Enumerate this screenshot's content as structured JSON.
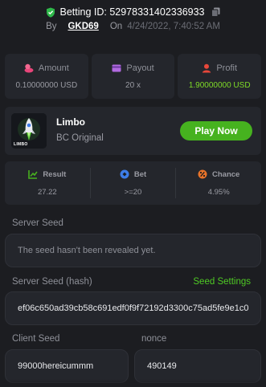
{
  "header": {
    "betting_id": "Betting ID: 52978331402336933",
    "by_label": "By",
    "username": "GKD69",
    "on_label": "On",
    "date": "4/24/2022, 7:40:52 AM"
  },
  "stats": [
    {
      "label": "Amount",
      "value": "0.10000000 USD",
      "icon": "coins-icon",
      "color": "#e8457a"
    },
    {
      "label": "Payout",
      "value": "20 x",
      "icon": "card-icon",
      "color": "#b26ae0"
    },
    {
      "label": "Profit",
      "value": "1.90000000 USD",
      "icon": "user-profit-icon",
      "color": "#e8473a"
    }
  ],
  "game": {
    "title": "Limbo",
    "subtitle": "BC Original",
    "thumb_text": "LIMBO",
    "play_label": "Play Now"
  },
  "results": [
    {
      "label": "Result",
      "value": "27.22",
      "icon": "chart-icon",
      "color": "#47b01f"
    },
    {
      "label": "Bet",
      "value": ">=20",
      "icon": "bet-icon",
      "color": "#3d7de8"
    },
    {
      "label": "Chance",
      "value": "4.95%",
      "icon": "percent-icon",
      "color": "#e8732a"
    }
  ],
  "seeds": {
    "server_seed_label": "Server Seed",
    "server_seed_value": "The seed hasn't been revealed yet.",
    "server_hash_label": "Server Seed (hash)",
    "seed_settings_label": "Seed Settings",
    "server_hash_value": "ef06c650ad39cb58c691edf0f9f72192d3300c75ad5fe9e1c0",
    "client_seed_label": "Client Seed",
    "client_seed_value": "99000hereicummm",
    "nonce_label": "nonce",
    "nonce_value": "490149"
  },
  "colors": {
    "background": "#1c1d21",
    "card": "#24262c",
    "accent_green": "#46b21f",
    "profit_green": "#7fdc27"
  }
}
